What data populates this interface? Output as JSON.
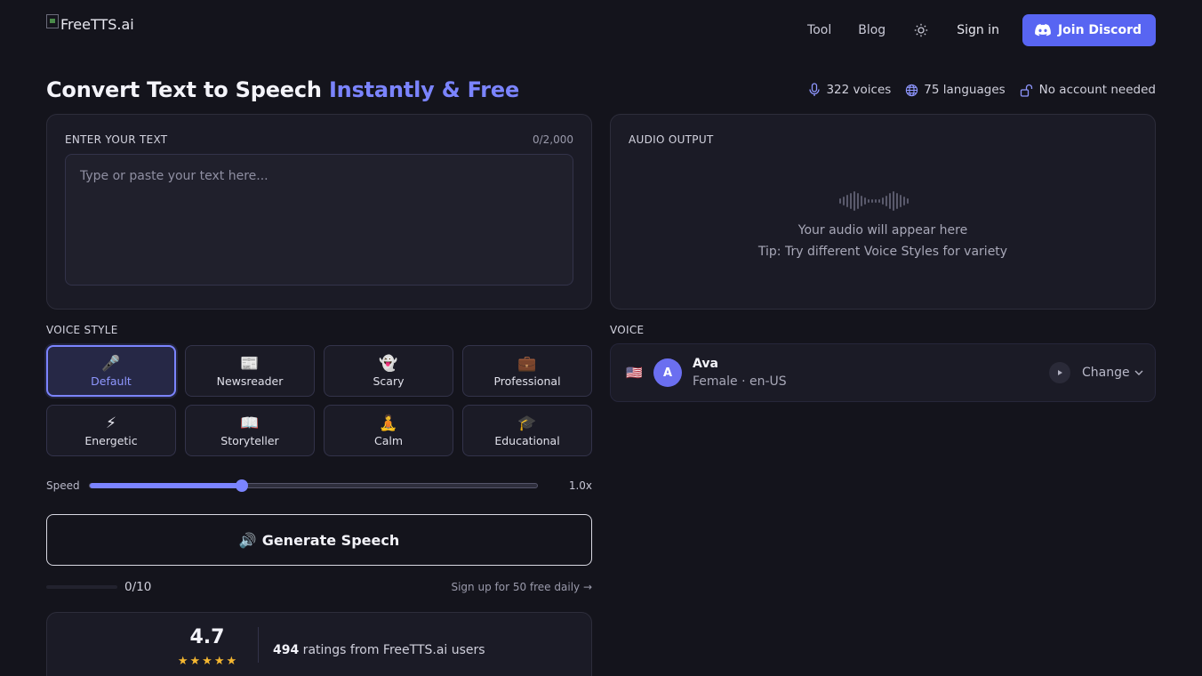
{
  "header": {
    "logo_alt": "FreeTTS.ai",
    "nav": [
      {
        "label": "Tool"
      },
      {
        "label": "Blog"
      }
    ],
    "theme_icon": "sun-icon",
    "signin_label": "Sign in",
    "discord_label": "Join Discord",
    "discord_icon": "discord-icon"
  },
  "hero": {
    "title_main": "Convert Text to Speech ",
    "title_accent": "Instantly & Free",
    "stats": [
      {
        "icon": "microphone-icon",
        "text": "322 voices"
      },
      {
        "icon": "globe-icon",
        "text": "75 languages"
      },
      {
        "icon": "unlock-icon",
        "text": "No account needed"
      }
    ]
  },
  "input": {
    "label": "ENTER YOUR TEXT",
    "char_count": "0/2,000",
    "value": "",
    "placeholder": "Type or paste your text here..."
  },
  "output": {
    "label": "AUDIO OUTPUT",
    "icon": "waveform-icon",
    "message": "Your audio will appear here",
    "tip": "Tip: Try different Voice Styles for variety"
  },
  "voice_style": {
    "label": "VOICE STYLE",
    "selected": "Default",
    "options": [
      {
        "emoji": "🎤",
        "label": "Default",
        "active": true
      },
      {
        "emoji": "📰",
        "label": "Newsreader",
        "active": false
      },
      {
        "emoji": "👻",
        "label": "Scary",
        "active": false
      },
      {
        "emoji": "💼",
        "label": "Professional",
        "active": false
      },
      {
        "emoji": "⚡",
        "label": "Energetic",
        "active": false
      },
      {
        "emoji": "📖",
        "label": "Storyteller",
        "active": false
      },
      {
        "emoji": "🧘",
        "label": "Calm",
        "active": false
      },
      {
        "emoji": "🎓",
        "label": "Educational",
        "active": false
      }
    ]
  },
  "speed": {
    "label": "Speed",
    "value_label": "1.0x",
    "fraction": 0.34
  },
  "generate": {
    "emoji": "🔊",
    "label": "Generate Speech"
  },
  "usage": {
    "count": "0/10",
    "fraction": 0,
    "signup": "Sign up for 50 free daily →"
  },
  "rating": {
    "score": "4.7",
    "stars": 5,
    "count": "494",
    "text": " ratings from FreeTTS.ai users"
  },
  "voice": {
    "label": "VOICE",
    "flag": "🇺🇸",
    "avatar_letter": "A",
    "name": "Ava",
    "meta": "Female · en-US",
    "play_icon": "play-icon",
    "change_label": "Change",
    "change_icon": "chevron-down-icon"
  },
  "colors": {
    "background": "#14141c",
    "panel": "#1b1b26",
    "accent": "#7b84ff",
    "discord": "#5865f2",
    "star": "#f5b731"
  }
}
